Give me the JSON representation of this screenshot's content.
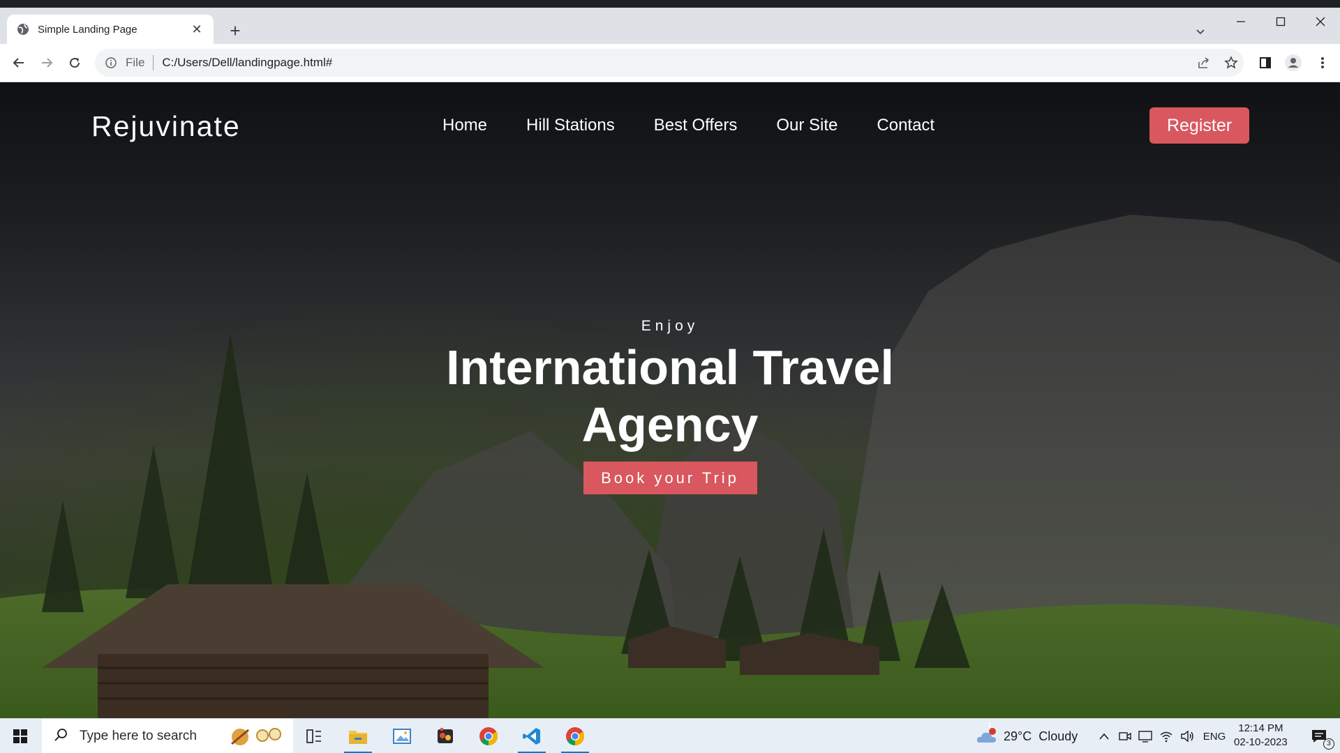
{
  "browser": {
    "tab_title": "Simple Landing Page",
    "address_scheme": "File",
    "address_url": "C:/Users/Dell/landingpage.html#"
  },
  "site": {
    "brand": "Rejuvinate",
    "nav": [
      "Home",
      "Hill Stations",
      "Best Offers",
      "Our Site",
      "Contact"
    ],
    "register_label": "Register",
    "hero": {
      "eyebrow": "Enjoy",
      "title_line1": "International Travel",
      "title_line2": "Agency",
      "cta_label": "Book your Trip"
    },
    "colors": {
      "accent": "#d9575e"
    }
  },
  "taskbar": {
    "search_placeholder": "Type here to search",
    "weather": "29°C  Cloudy",
    "weather_badge": "1",
    "language": "ENG",
    "time": "12:14 PM",
    "date": "02-10-2023",
    "notifications": "3"
  }
}
